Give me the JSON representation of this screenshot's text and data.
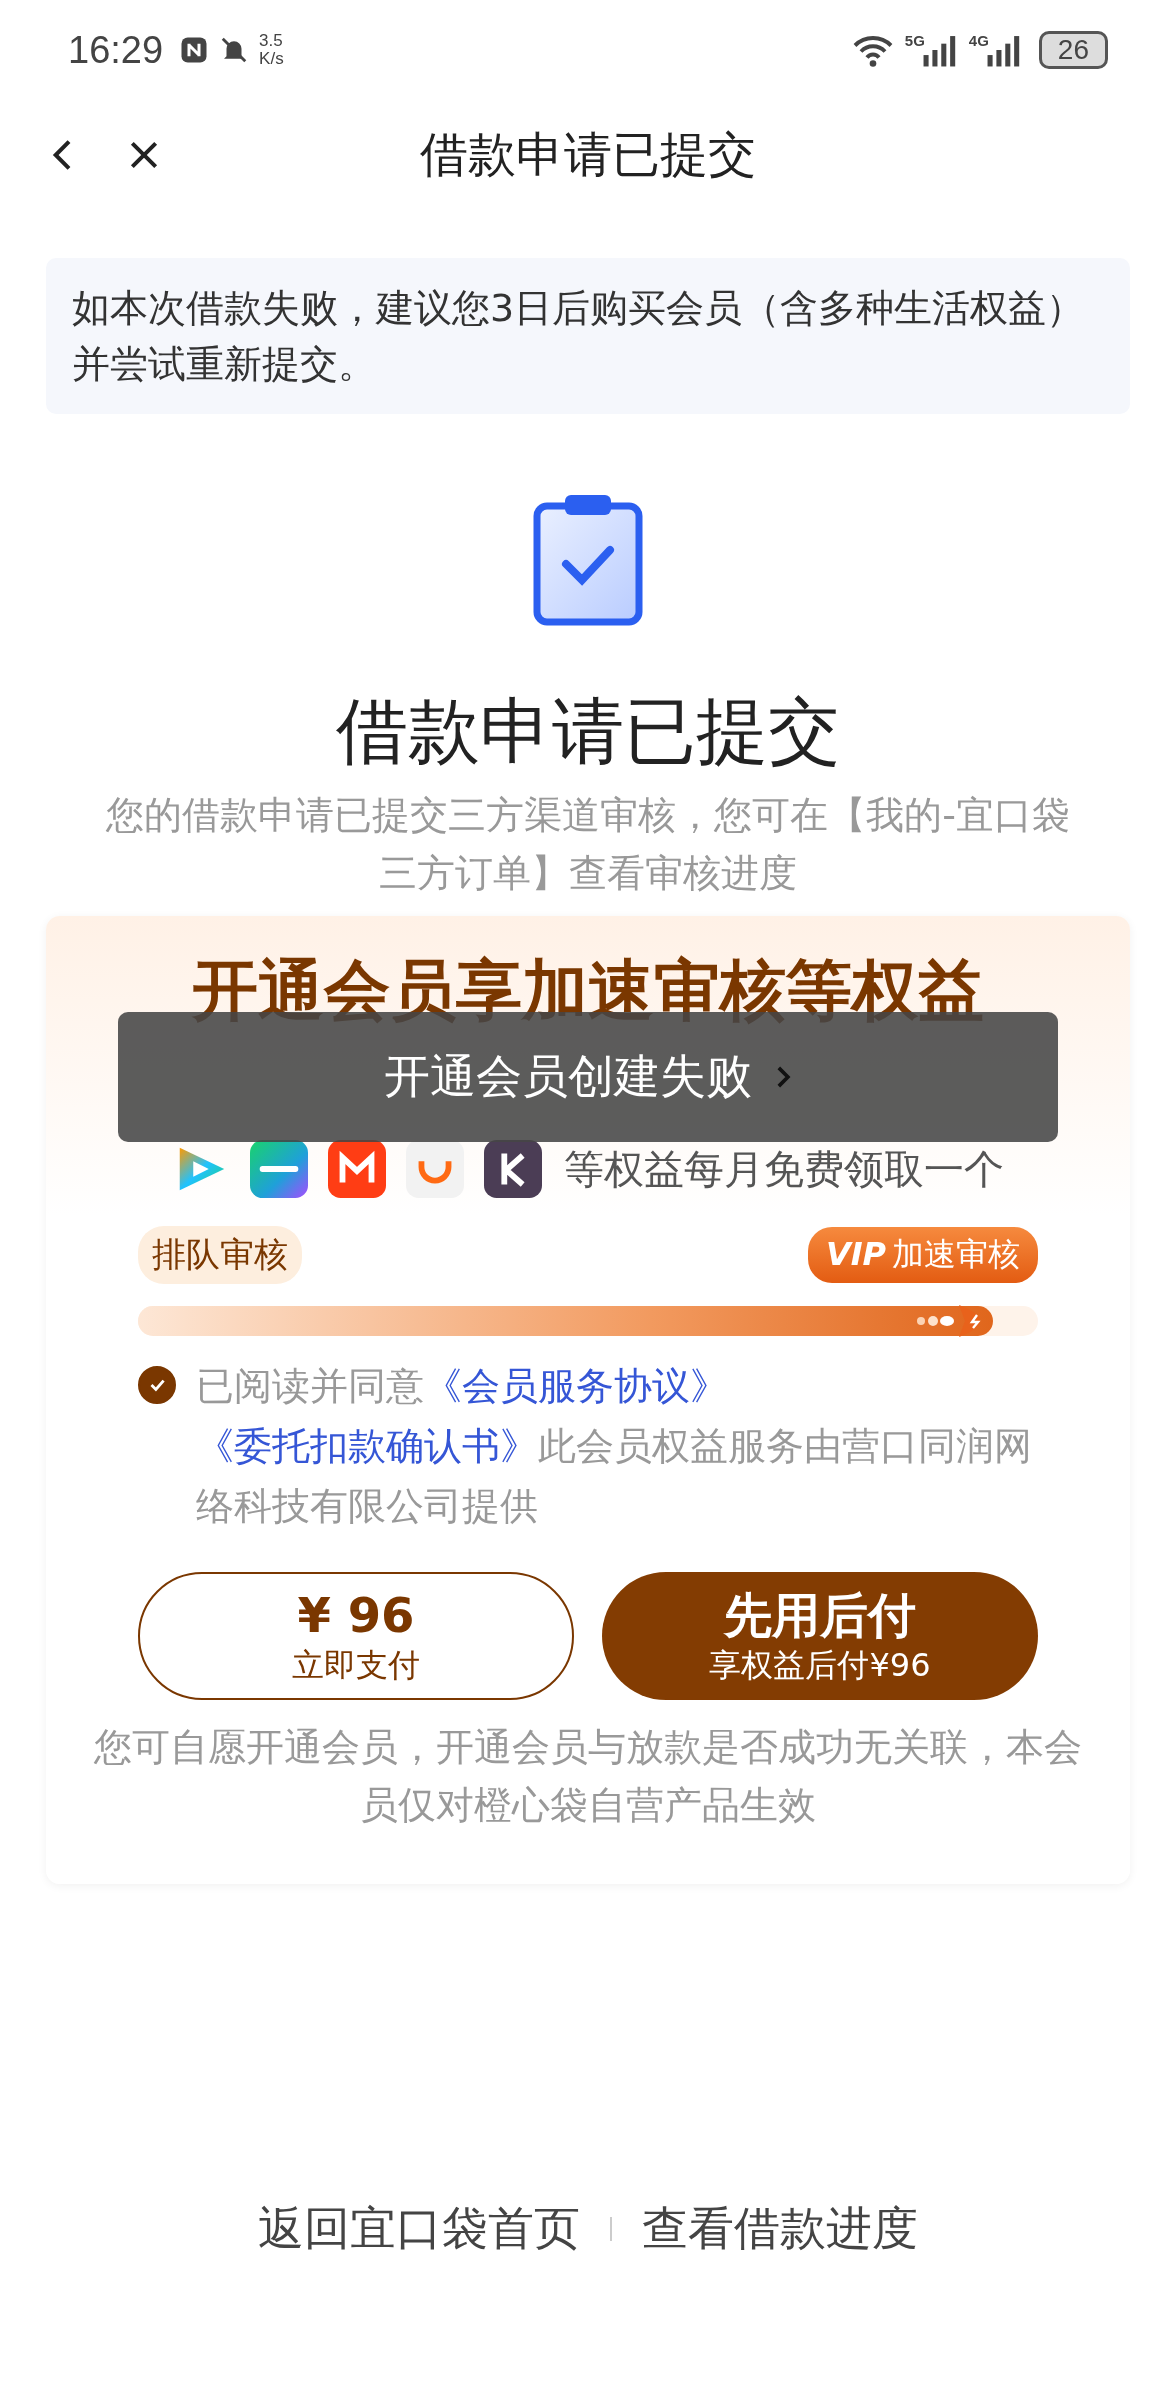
{
  "status_bar": {
    "time": "16:29",
    "speed_value": "3.5",
    "speed_unit": "K/s",
    "battery": "26",
    "networks": [
      "5G",
      "4G"
    ]
  },
  "header": {
    "title": "借款申请已提交"
  },
  "notice": "如本次借款失败，建议您3日后购买会员（含多种生活权益）并尝试重新提交。",
  "result": {
    "title": "借款申请已提交",
    "description": "您的借款申请已提交三方渠道审核，您可在【我的-宜口袋三方订单】查看审核进度"
  },
  "member_card": {
    "title": "开通会员享加速审核等权益",
    "benefits_text": "等权益每月免费领取一个",
    "queue_label": "排队审核",
    "vip_label": "加速审核",
    "vip_mark": "VIP",
    "level": 0.95,
    "agreement": {
      "checked": true,
      "prefix": "已阅读并同意",
      "links": [
        "《会员服务协议》",
        "《委托扣款确认书》"
      ],
      "suffix": "此会员权益服务由营口同润网络科技有限公司提供"
    },
    "buttons": [
      {
        "kind": "outline",
        "main": "¥ 96",
        "sub": "立即支付"
      },
      {
        "kind": "filled",
        "main": "先用后付",
        "sub": "享权益后付¥96"
      }
    ],
    "note": "您可自愿开通会员，开通会员与放款是否成功无关联，本会员仅对橙心袋自营产品生效"
  },
  "toast": "开通会员创建失败",
  "footer_links": [
    "返回宜口袋首页",
    "查看借款进度"
  ]
}
